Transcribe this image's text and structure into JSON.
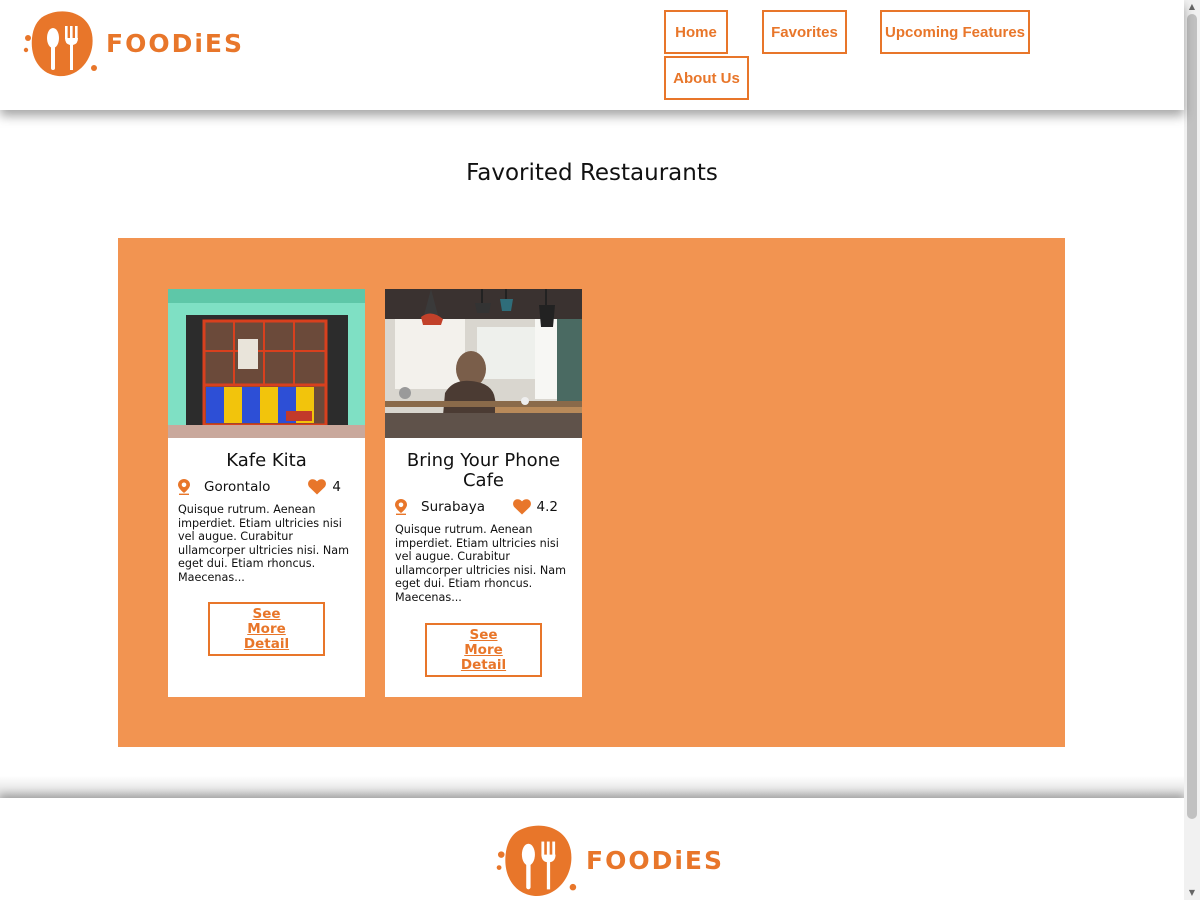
{
  "brand": {
    "name": "FOODiES",
    "accent": "#e8762a",
    "panel_color": "#f29451"
  },
  "nav": {
    "home": "Home",
    "favorites": "Favorites",
    "upcoming": "Upcoming Features",
    "about": "About Us"
  },
  "page": {
    "title": "Favorited Restaurants"
  },
  "restaurants": [
    {
      "name": "Kafe Kita",
      "city": "Gorontalo",
      "rating": "4",
      "description": "Quisque rutrum. Aenean imperdiet. Etiam ultricies nisi vel augue. Curabitur ullamcorper ultricies nisi. Nam eget dui. Etiam rhoncus. Maecenas...",
      "button_label": "See More Detail",
      "icons": [
        "pin-icon",
        "heart-icon"
      ]
    },
    {
      "name": "Bring Your Phone Cafe",
      "city": "Surabaya",
      "rating": "4.2",
      "description": "Quisque rutrum. Aenean imperdiet. Etiam ultricies nisi vel augue. Curabitur ullamcorper ultricies nisi. Nam eget dui. Etiam rhoncus. Maecenas...",
      "button_label": "See More Detail",
      "icons": [
        "pin-icon",
        "heart-icon"
      ]
    }
  ],
  "footer": {
    "brand": "FOODiES"
  }
}
